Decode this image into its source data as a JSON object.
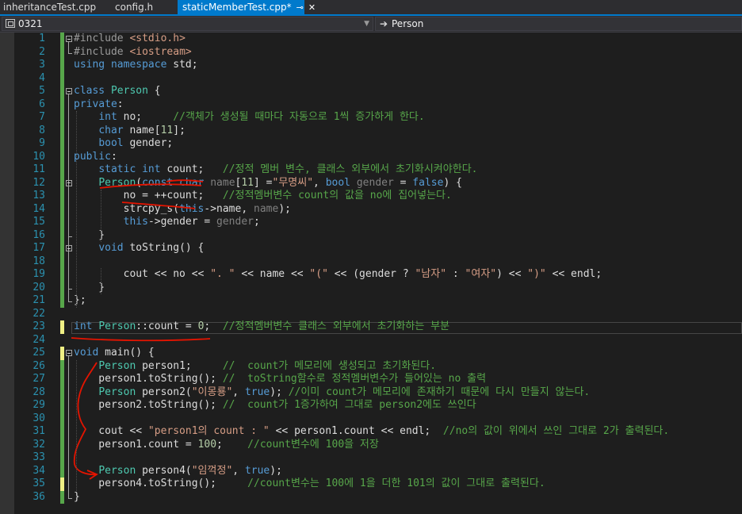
{
  "tabs": [
    {
      "label": "inheritanceTest.cpp"
    },
    {
      "label": "config.h"
    },
    {
      "label": "staticMemberTest.cpp*",
      "pin_icon": "pin-icon",
      "close_icon": "close-icon"
    }
  ],
  "navbar": {
    "scope_value": "0321",
    "scope_icon": "scope-icon",
    "member_value": "Person",
    "member_icon": "arrow-right-icon"
  },
  "colors": {
    "accent": "#007acc",
    "changed_saved": "#57a64a",
    "changed_unsaved": "#efef84",
    "keyword": "#569cd6",
    "type": "#4ec9b0",
    "string": "#d69d85",
    "comment": "#57a64a",
    "line_number": "#2b91af",
    "annotation": "#e51400"
  },
  "editor": {
    "lines": [
      {
        "n": "1",
        "fold": "open",
        "change": "saved",
        "tokens": [
          [
            "pp",
            "#include "
          ],
          [
            "str",
            "<stdio.h>"
          ]
        ]
      },
      {
        "n": "2",
        "change": "saved",
        "tokens": [
          [
            "pp",
            "#include "
          ],
          [
            "str",
            "<iostream>"
          ]
        ]
      },
      {
        "n": "3",
        "change": "saved",
        "tokens": [
          [
            "kw",
            "using"
          ],
          [
            "tx",
            " "
          ],
          [
            "kw",
            "namespace"
          ],
          [
            "tx",
            " std;"
          ]
        ]
      },
      {
        "n": "4",
        "change": "saved",
        "tokens": []
      },
      {
        "n": "5",
        "fold": "open",
        "change": "saved",
        "tokens": [
          [
            "kw",
            "class"
          ],
          [
            "tx",
            " "
          ],
          [
            "ty",
            "Person"
          ],
          [
            "tx",
            " {"
          ]
        ]
      },
      {
        "n": "6",
        "change": "saved",
        "tokens": [
          [
            "kw",
            "private"
          ],
          [
            "tx",
            ":"
          ]
        ]
      },
      {
        "n": "7",
        "change": "saved",
        "tokens": [
          [
            "tx",
            "    "
          ],
          [
            "kw",
            "int"
          ],
          [
            "tx",
            " no;     "
          ],
          [
            "cm",
            "//객체가 생성될 때마다 자동으로 1씩 증가하게 한다."
          ]
        ]
      },
      {
        "n": "8",
        "change": "saved",
        "tokens": [
          [
            "tx",
            "    "
          ],
          [
            "kw",
            "char"
          ],
          [
            "tx",
            " name["
          ],
          [
            "nm",
            "11"
          ],
          [
            "tx",
            "];"
          ]
        ]
      },
      {
        "n": "9",
        "change": "saved",
        "tokens": [
          [
            "tx",
            "    "
          ],
          [
            "kw",
            "bool"
          ],
          [
            "tx",
            " gender;"
          ]
        ]
      },
      {
        "n": "10",
        "change": "saved",
        "tokens": [
          [
            "kw",
            "public"
          ],
          [
            "tx",
            ":"
          ]
        ]
      },
      {
        "n": "11",
        "change": "saved",
        "tokens": [
          [
            "tx",
            "    "
          ],
          [
            "kw",
            "static"
          ],
          [
            "tx",
            " "
          ],
          [
            "kw",
            "int"
          ],
          [
            "tx",
            " count;   "
          ],
          [
            "cm",
            "//정적 멤버 변수, 클래스 외부에서 초기화시켜야한다."
          ]
        ]
      },
      {
        "n": "12",
        "fold": "open",
        "change": "saved",
        "tokens": [
          [
            "tx",
            "    "
          ],
          [
            "ty",
            "Person"
          ],
          [
            "tx",
            "("
          ],
          [
            "kw",
            "const"
          ],
          [
            "tx",
            " "
          ],
          [
            "kw",
            "char"
          ],
          [
            "tx",
            " "
          ],
          [
            "pr",
            "name"
          ],
          [
            "tx",
            "["
          ],
          [
            "nm",
            "11"
          ],
          [
            "tx",
            "] ="
          ],
          [
            "str",
            "\"무명씨\""
          ],
          [
            "tx",
            ", "
          ],
          [
            "kw",
            "bool"
          ],
          [
            "tx",
            " "
          ],
          [
            "pr",
            "gender"
          ],
          [
            "tx",
            " = "
          ],
          [
            "kw",
            "false"
          ],
          [
            "tx",
            ") {"
          ]
        ]
      },
      {
        "n": "13",
        "change": "saved",
        "tokens": [
          [
            "tx",
            "        no = ++count;   "
          ],
          [
            "cm",
            "//정적멤버변수 count의 값을 no에 집어넣는다."
          ]
        ]
      },
      {
        "n": "14",
        "change": "saved",
        "tokens": [
          [
            "tx",
            "        strcpy_s("
          ],
          [
            "kw",
            "this"
          ],
          [
            "tx",
            "->name, "
          ],
          [
            "pr",
            "name"
          ],
          [
            "tx",
            ");"
          ]
        ]
      },
      {
        "n": "15",
        "change": "saved",
        "tokens": [
          [
            "tx",
            "        "
          ],
          [
            "kw",
            "this"
          ],
          [
            "tx",
            "->gender = "
          ],
          [
            "pr",
            "gender"
          ],
          [
            "tx",
            ";"
          ]
        ]
      },
      {
        "n": "16",
        "change": "saved",
        "tokens": [
          [
            "tx",
            "    }"
          ]
        ]
      },
      {
        "n": "17",
        "fold": "open",
        "change": "saved",
        "tokens": [
          [
            "tx",
            "    "
          ],
          [
            "kw",
            "void"
          ],
          [
            "tx",
            " toString() {"
          ]
        ]
      },
      {
        "n": "18",
        "change": "saved",
        "tokens": []
      },
      {
        "n": "19",
        "change": "saved",
        "tokens": [
          [
            "tx",
            "        cout << no << "
          ],
          [
            "str",
            "\". \""
          ],
          [
            "tx",
            " << name << "
          ],
          [
            "str",
            "\"(\""
          ],
          [
            "tx",
            " << (gender ? "
          ],
          [
            "str",
            "\"남자\""
          ],
          [
            "tx",
            " : "
          ],
          [
            "str",
            "\"여자\""
          ],
          [
            "tx",
            ") << "
          ],
          [
            "str",
            "\")\""
          ],
          [
            "tx",
            " << endl;"
          ]
        ]
      },
      {
        "n": "20",
        "change": "saved",
        "tokens": [
          [
            "tx",
            "    }"
          ]
        ]
      },
      {
        "n": "21",
        "change": "saved",
        "tokens": [
          [
            "tx",
            "};"
          ]
        ]
      },
      {
        "n": "22",
        "change": "none",
        "tokens": []
      },
      {
        "n": "23",
        "change": "unsaved",
        "tokens": [
          [
            "kw",
            "int"
          ],
          [
            "tx",
            " "
          ],
          [
            "ty",
            "Person"
          ],
          [
            "tx",
            "::count = "
          ],
          [
            "nm",
            "0"
          ],
          [
            "tx",
            ";  "
          ],
          [
            "cm",
            "//정적멤버변수 클래스 외부에서 초기화하는 부분"
          ]
        ]
      },
      {
        "n": "24",
        "change": "none",
        "tokens": []
      },
      {
        "n": "25",
        "fold": "open",
        "change": "unsaved",
        "tokens": [
          [
            "kw",
            "void"
          ],
          [
            "tx",
            " main() {"
          ]
        ]
      },
      {
        "n": "26",
        "change": "saved",
        "tokens": [
          [
            "tx",
            "    "
          ],
          [
            "ty",
            "Person"
          ],
          [
            "tx",
            " person1;     "
          ],
          [
            "cm",
            "//  count가 메모리에 생성되고 초기화된다."
          ]
        ]
      },
      {
        "n": "27",
        "change": "saved",
        "tokens": [
          [
            "tx",
            "    person1.toString(); "
          ],
          [
            "cm",
            "//  toString함수로 정적멤버변수가 들어있는 no 출력"
          ]
        ]
      },
      {
        "n": "28",
        "change": "saved",
        "tokens": [
          [
            "tx",
            "    "
          ],
          [
            "ty",
            "Person"
          ],
          [
            "tx",
            " person2("
          ],
          [
            "str",
            "\"이몽룡\""
          ],
          [
            "tx",
            ", "
          ],
          [
            "kw",
            "true"
          ],
          [
            "tx",
            "); "
          ],
          [
            "cm",
            "//이미 count가 메모리에 존재하기 때문에 다시 만들지 않는다."
          ]
        ]
      },
      {
        "n": "29",
        "change": "saved",
        "tokens": [
          [
            "tx",
            "    person2.toString(); "
          ],
          [
            "cm",
            "//  count가 1증가하여 그대로 person2에도 쓰인다"
          ]
        ]
      },
      {
        "n": "30",
        "change": "saved",
        "tokens": []
      },
      {
        "n": "31",
        "change": "saved",
        "tokens": [
          [
            "tx",
            "    cout << "
          ],
          [
            "str",
            "\"person1의 count : \""
          ],
          [
            "tx",
            " << person1.count << endl;  "
          ],
          [
            "cm",
            "//no의 값이 위에서 쓰인 그대로 2가 출력된다."
          ]
        ]
      },
      {
        "n": "32",
        "change": "saved",
        "tokens": [
          [
            "tx",
            "    person1.count = "
          ],
          [
            "nm",
            "100"
          ],
          [
            "tx",
            ";    "
          ],
          [
            "cm",
            "//count변수에 100을 저장"
          ]
        ]
      },
      {
        "n": "33",
        "change": "saved",
        "tokens": []
      },
      {
        "n": "34",
        "change": "saved",
        "tokens": [
          [
            "tx",
            "    "
          ],
          [
            "ty",
            "Person"
          ],
          [
            "tx",
            " person4("
          ],
          [
            "str",
            "\"임꺽정\""
          ],
          [
            "tx",
            ", "
          ],
          [
            "kw",
            "true"
          ],
          [
            "tx",
            ");"
          ]
        ]
      },
      {
        "n": "35",
        "change": "unsaved",
        "tokens": [
          [
            "tx",
            "    person4.toString();     "
          ],
          [
            "cm",
            "//count변수는 100에 1을 더한 101의 값이 그대로 출력된다."
          ]
        ]
      },
      {
        "n": "36",
        "change": "saved",
        "tokens": [
          [
            "tx",
            "}"
          ]
        ]
      }
    ]
  }
}
